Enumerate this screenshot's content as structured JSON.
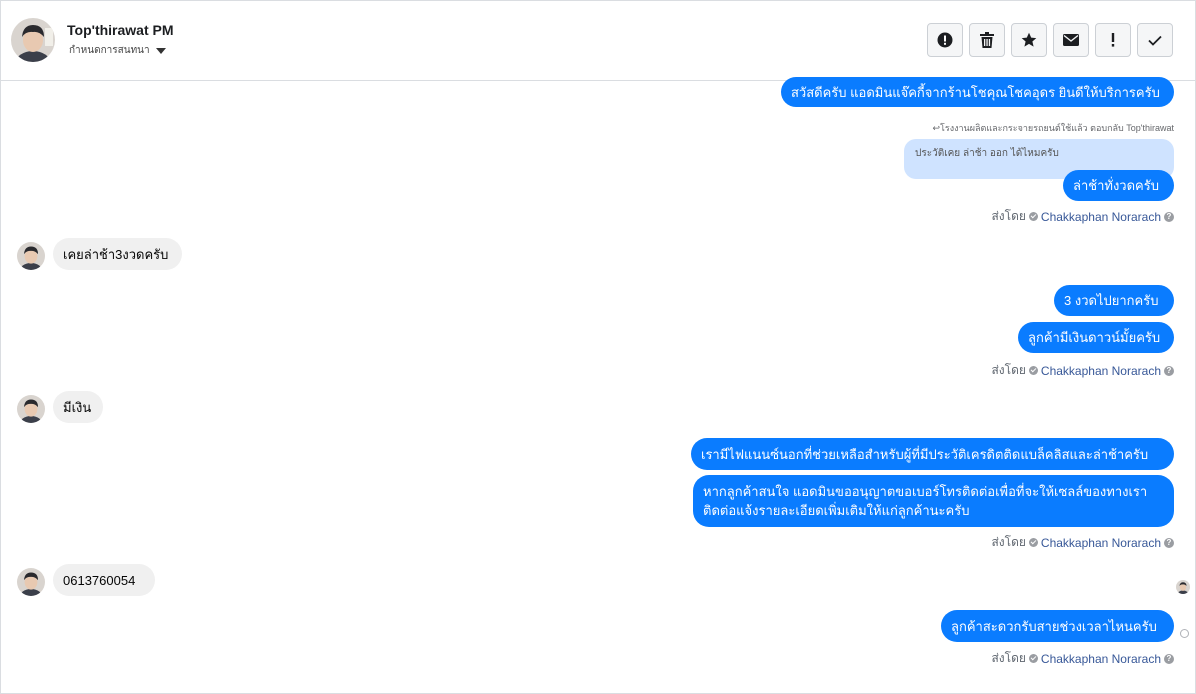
{
  "header": {
    "name": "Top'thirawat PM",
    "subtitle": "กำหนดการสนทนา",
    "toolbar": [
      {
        "icon": "alert-circle-icon"
      },
      {
        "icon": "trash-icon"
      },
      {
        "icon": "star-icon"
      },
      {
        "icon": "envelope-icon"
      },
      {
        "icon": "exclamation-icon"
      },
      {
        "icon": "check-icon"
      }
    ]
  },
  "messages": {
    "m1": "สวัสดีครับ แอดมินแจ๊คกี้จากร้านโชคุณโชคอุดร ยินดีให้บริการครับ",
    "reply_note": "↩︎โรงงานผลิตและกระจายรถยนต์ใช้แล้ว ตอบกลับ Top'thirawat",
    "quoted": "ประวัติเคย ล่าช้า ออก ได้ไหมครับ",
    "m2": "ล่าช้าทั่งวดครับ",
    "in1": "เคยล่าช้า3งวดครับ",
    "m3": "3 งวดไปยากครับ",
    "m4": "ลูกค้ามีเงินดาวน์มั้ยครับ",
    "in2": "มีเงิน",
    "m5": "เรามีไฟแนนซ์นอกที่ช่วยเหลือสำหรับผู้ที่มีประวัติเครดิตติดแบล็คลิสและล่าช้าครับ",
    "m6": "หากลูกค้าสนใจ แอดมินขออนุญาตขอเบอร์โทรติดต่อเพื่อที่จะให้เซลล์ของทางเราติดต่อแจ้งรายละเอียดเพิ่มเติมให้แก่ลูกค้านะครับ",
    "in3": "0613760054",
    "m7": "ลูกค้าสะดวกรับสายช่วงเวลาไหนครับ"
  },
  "sent_by": {
    "prefix": "ส่งโดย",
    "agent": "Chakkaphan Norarach",
    "help": "?"
  },
  "colors": {
    "outgoing": "#0a7cff",
    "incoming": "#f0f0f0",
    "agent_link": "#385898"
  }
}
